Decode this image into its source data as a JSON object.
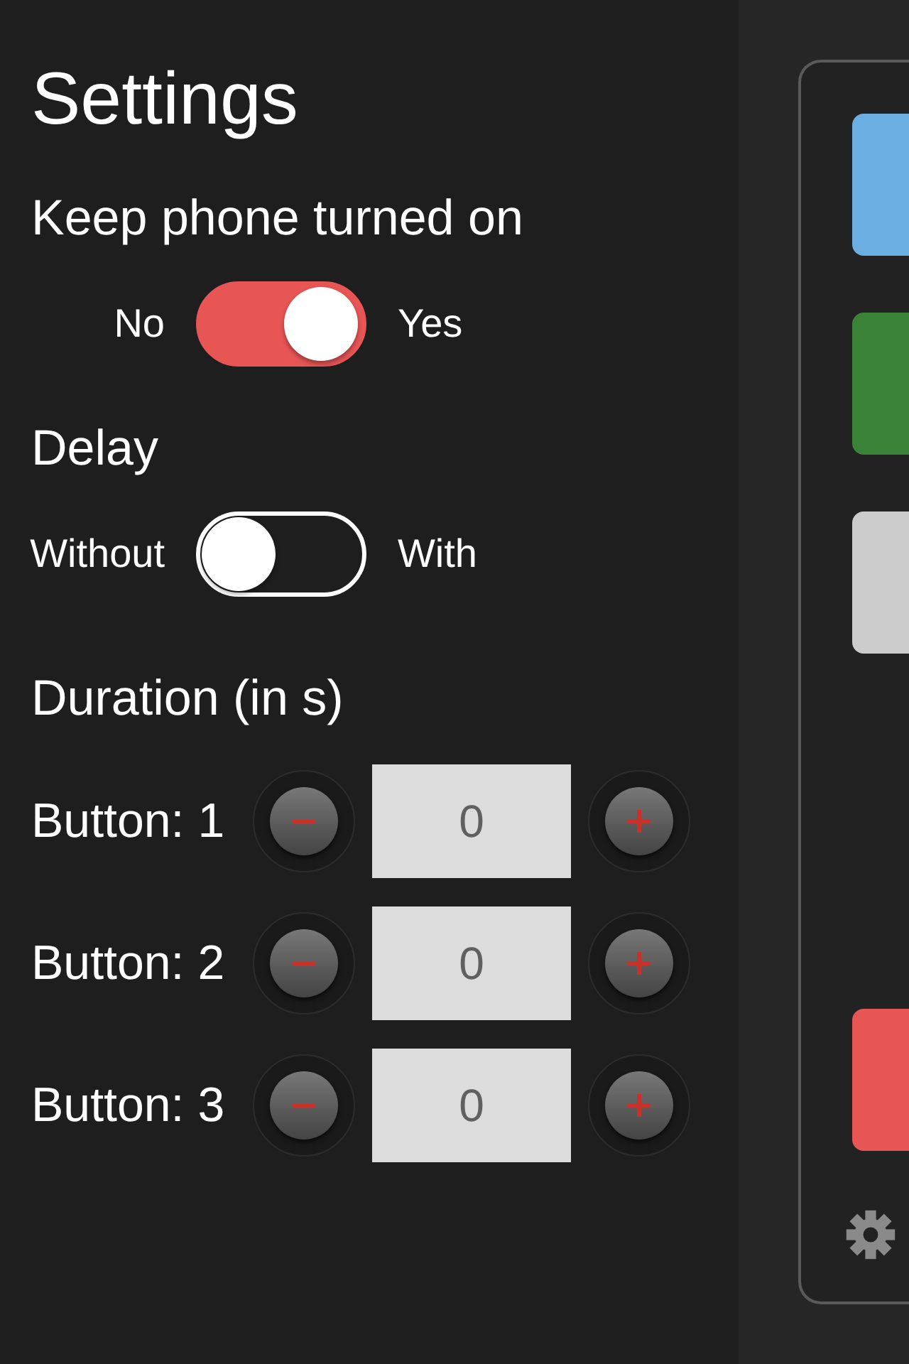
{
  "title": "Settings",
  "switches": [
    {
      "label": "Keep phone turned on",
      "off_label": "No",
      "on_label": "Yes",
      "on": true
    },
    {
      "label": "Delay",
      "off_label": "Without",
      "on_label": "With",
      "on": false
    }
  ],
  "duration": {
    "label": "Duration (in s)",
    "rows": [
      {
        "label": "Button: 1",
        "value": "0"
      },
      {
        "label": "Button: 2",
        "value": "0"
      },
      {
        "label": "Button: 3",
        "value": "0"
      }
    ]
  },
  "tiles": [
    {
      "color": "#6aaee2"
    },
    {
      "color": "#3a8238"
    },
    {
      "color": "#cccccc"
    },
    {
      "color": "#e85555"
    }
  ]
}
